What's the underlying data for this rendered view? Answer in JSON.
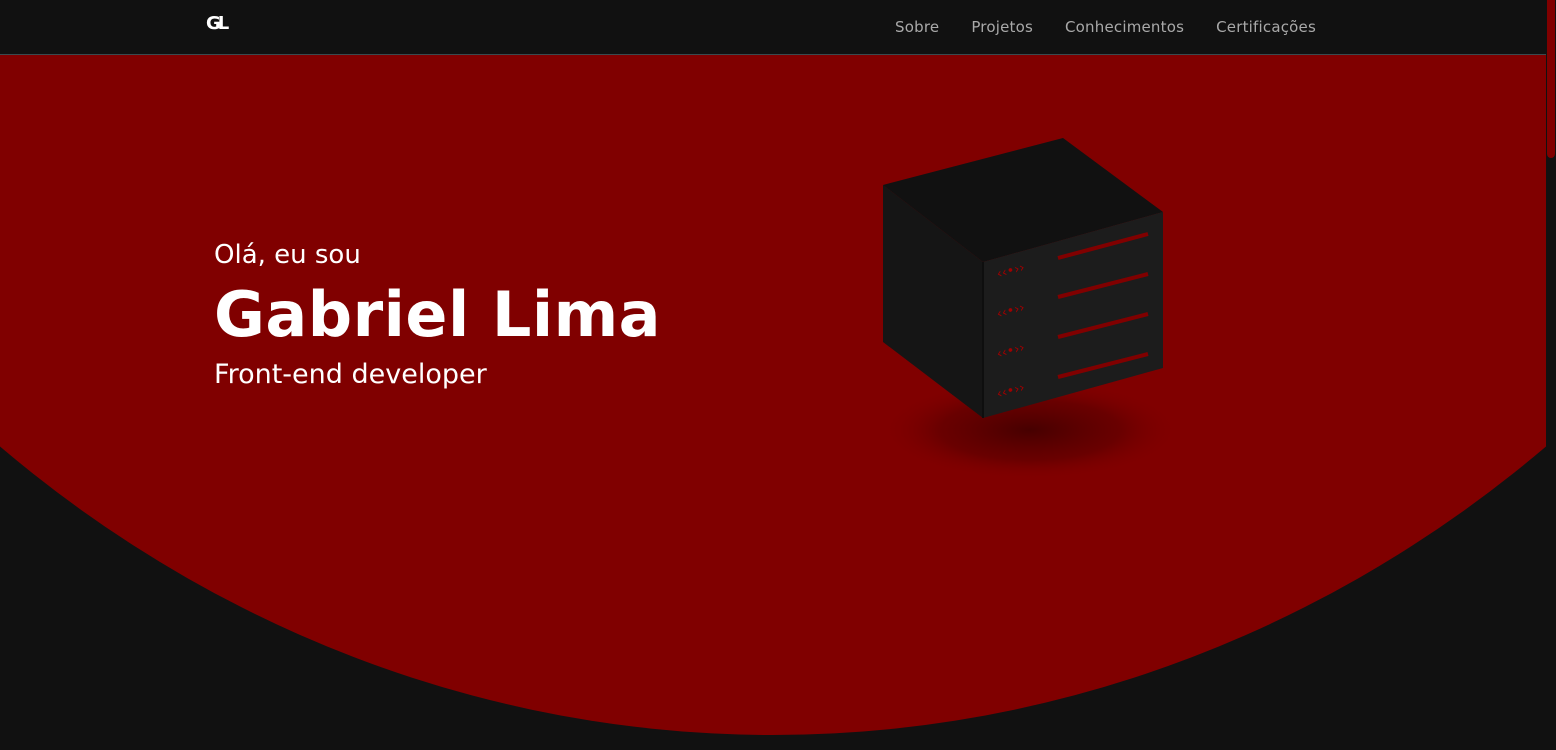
{
  "header": {
    "logo_text": "GL",
    "nav": [
      {
        "label": "Sobre"
      },
      {
        "label": "Projetos"
      },
      {
        "label": "Conhecimentos"
      },
      {
        "label": "Certificações"
      }
    ]
  },
  "hero": {
    "greeting": "Olá, eu sou",
    "name": "Gabriel Lima",
    "role": "Front-end developer",
    "illustration": "server-icon"
  },
  "colors": {
    "background": "#111111",
    "accent": "#800000",
    "text": "#ffffff",
    "nav_text": "#a9a9a9"
  }
}
